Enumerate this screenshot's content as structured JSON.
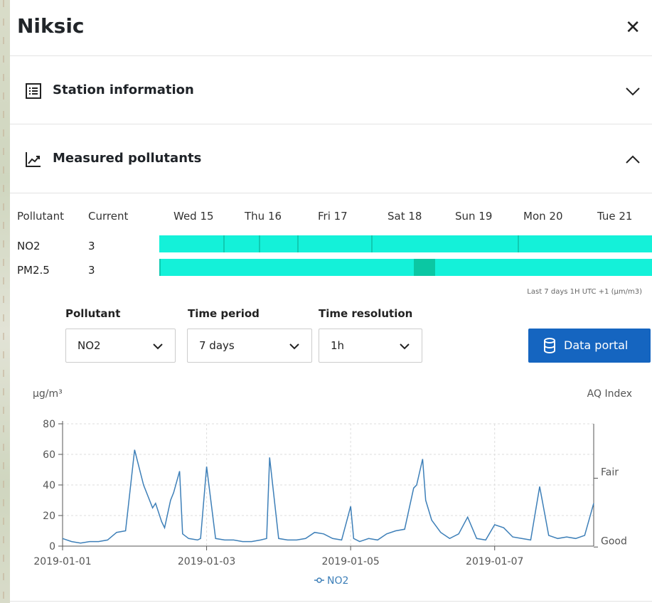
{
  "panel": {
    "title": "Niksic",
    "close_icon": "close-icon"
  },
  "sections": [
    {
      "label": "Station information",
      "icon": "list-icon",
      "state": "collapsed"
    },
    {
      "label": "Measured pollutants",
      "icon": "chart-line-icon",
      "state": "expanded"
    }
  ],
  "table": {
    "headers": {
      "pollutant": "Pollutant",
      "current": "Current"
    },
    "days": [
      "Wed 15",
      "Thu 16",
      "Fri 17",
      "Sat 18",
      "Sun 19",
      "Mon 20",
      "Tue 21"
    ],
    "rows": [
      {
        "pollutant": "NO2",
        "current": "3"
      },
      {
        "pollutant": "PM2.5",
        "current": "3"
      }
    ],
    "note": "Last 7 days 1H UTC +1 (µm/m3)",
    "bar_color": "#14f1d9"
  },
  "filters": {
    "pollutant": {
      "label": "Pollutant",
      "value": "NO2"
    },
    "time_period": {
      "label": "Time period",
      "value": "7 days"
    },
    "time_resolution": {
      "label": "Time resolution",
      "value": "1h"
    }
  },
  "data_portal": {
    "label": "Data portal",
    "color": "#1565c0",
    "icon": "database-icon"
  },
  "chart_data": {
    "type": "line",
    "ylabel": "µg/m³",
    "y2label": "AQ Index",
    "ylim": [
      0,
      80
    ],
    "yticks": [
      0,
      20,
      40,
      60,
      80
    ],
    "xlim": [
      "2019-01-01",
      "2019-01-08 09:00"
    ],
    "xticks": [
      "2019-01-01",
      "2019-01-03",
      "2019-01-05",
      "2019-01-07"
    ],
    "index_labels": [
      {
        "label": "Fair",
        "value": 50
      },
      {
        "label": "Good",
        "value": 5
      }
    ],
    "grid": true,
    "legend_position": "bottom",
    "series": [
      {
        "name": "NO2",
        "color": "#3d7fb8",
        "x": [
          "2019-01-01 00:00",
          "2019-01-01 03:00",
          "2019-01-01 06:00",
          "2019-01-01 09:00",
          "2019-01-01 12:00",
          "2019-01-01 15:00",
          "2019-01-01 18:00",
          "2019-01-01 21:00",
          "2019-01-02 00:00",
          "2019-01-02 03:00",
          "2019-01-02 06:00",
          "2019-01-02 07:00",
          "2019-01-02 09:00",
          "2019-01-02 10:00",
          "2019-01-02 12:00",
          "2019-01-02 13:00",
          "2019-01-02 15:00",
          "2019-01-02 16:00",
          "2019-01-02 18:00",
          "2019-01-02 21:00",
          "2019-01-02 22:00",
          "2019-01-03 00:00",
          "2019-01-03 03:00",
          "2019-01-03 06:00",
          "2019-01-03 09:00",
          "2019-01-03 12:00",
          "2019-01-03 15:00",
          "2019-01-03 18:00",
          "2019-01-03 20:00",
          "2019-01-03 21:00",
          "2019-01-04 00:00",
          "2019-01-04 03:00",
          "2019-01-04 06:00",
          "2019-01-04 09:00",
          "2019-01-04 12:00",
          "2019-01-04 15:00",
          "2019-01-04 18:00",
          "2019-01-04 21:00",
          "2019-01-05 00:00",
          "2019-01-05 01:00",
          "2019-01-05 03:00",
          "2019-01-05 06:00",
          "2019-01-05 09:00",
          "2019-01-05 12:00",
          "2019-01-05 15:00",
          "2019-01-05 18:00",
          "2019-01-05 21:00",
          "2019-01-05 22:00",
          "2019-01-06 00:00",
          "2019-01-06 01:00",
          "2019-01-06 03:00",
          "2019-01-06 06:00",
          "2019-01-06 09:00",
          "2019-01-06 12:00",
          "2019-01-06 15:00",
          "2019-01-06 18:00",
          "2019-01-06 21:00",
          "2019-01-07 00:00",
          "2019-01-07 03:00",
          "2019-01-07 06:00",
          "2019-01-07 09:00",
          "2019-01-07 12:00",
          "2019-01-07 15:00",
          "2019-01-07 18:00",
          "2019-01-07 21:00",
          "2019-01-08 00:00",
          "2019-01-08 03:00",
          "2019-01-08 06:00",
          "2019-01-08 09:00"
        ],
        "y": [
          5,
          3,
          2,
          3,
          3,
          4,
          9,
          10,
          63,
          40,
          25,
          28,
          16,
          12,
          30,
          35,
          49,
          8,
          5,
          4,
          5,
          52,
          5,
          4,
          4,
          3,
          3,
          4,
          5,
          58,
          5,
          4,
          4,
          5,
          9,
          8,
          5,
          4,
          26,
          5,
          3,
          5,
          4,
          8,
          10,
          11,
          38,
          40,
          57,
          30,
          17,
          9,
          5,
          8,
          19,
          5,
          4,
          14,
          12,
          6,
          5,
          4,
          39,
          7,
          5,
          6,
          5,
          7,
          28
        ]
      }
    ]
  }
}
